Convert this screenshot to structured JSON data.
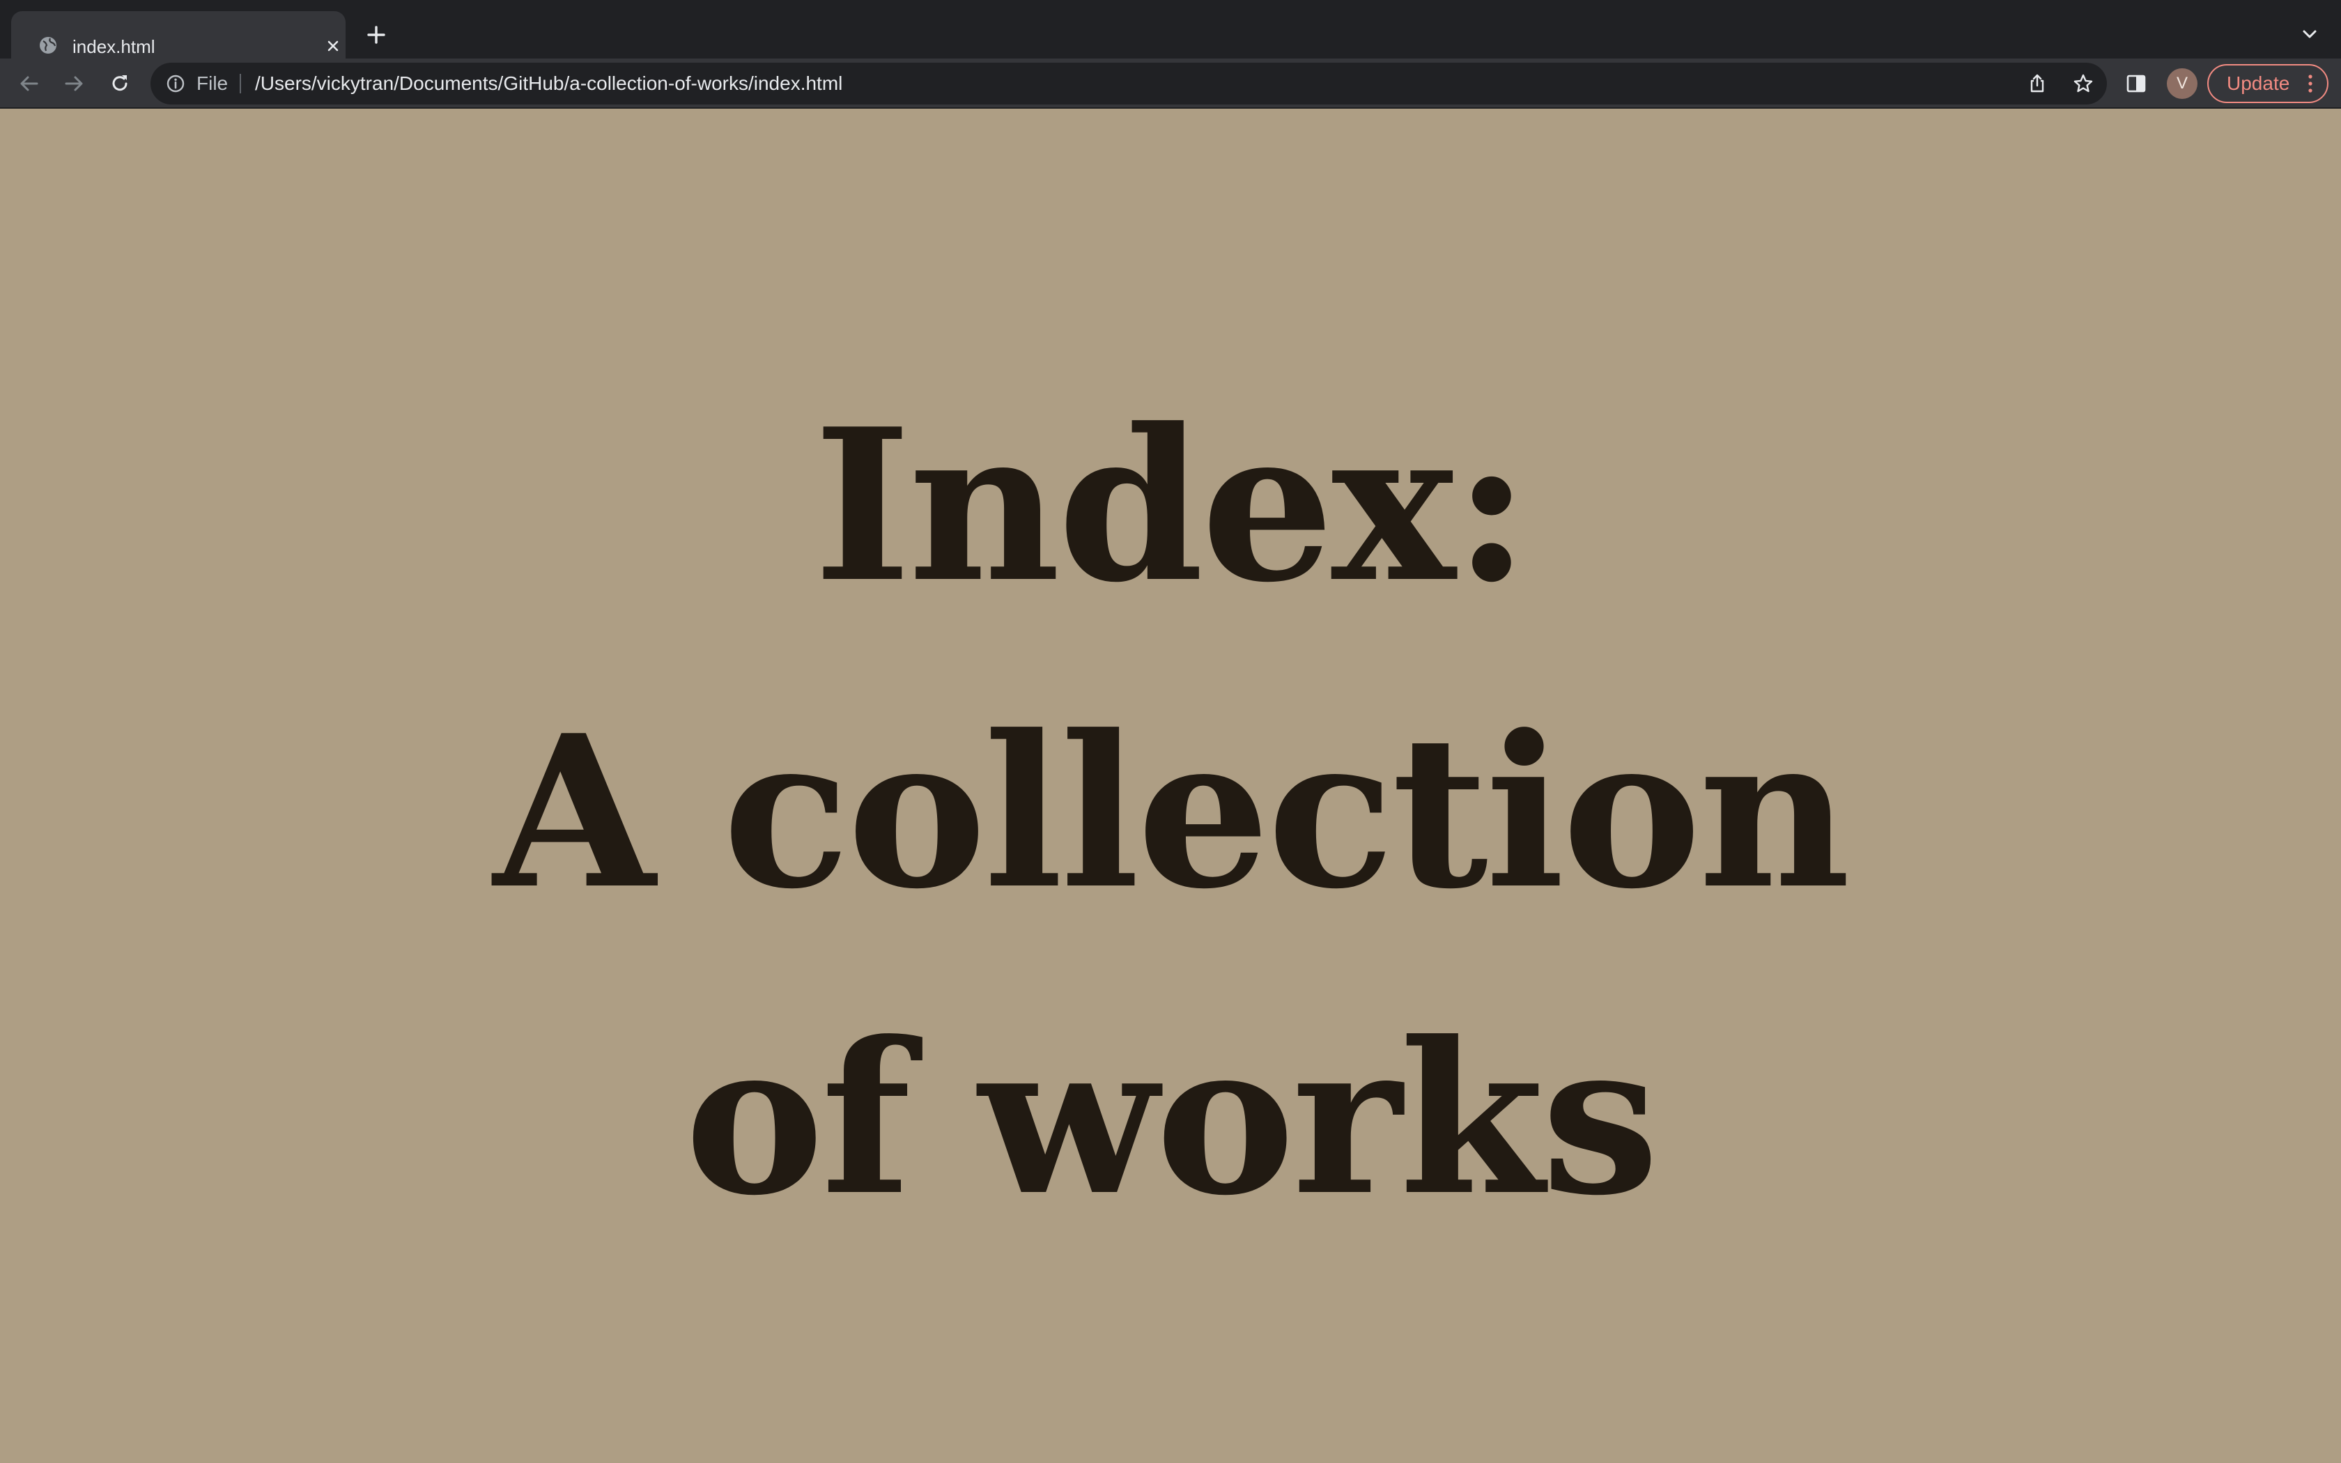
{
  "browser": {
    "tab": {
      "title": "index.html",
      "favicon": "globe-icon"
    },
    "new_tab_icon": "plus-icon",
    "tab_search_icon": "chevron-down-icon",
    "omnibox": {
      "scheme_label": "File",
      "url": "/Users/vickytran/Documents/GitHub/a-collection-of-works/index.html",
      "info_icon": "info-icon",
      "share_icon": "share-icon",
      "bookmark_icon": "star-icon"
    },
    "side_panel_icon": "side-panel-icon",
    "profile_initial": "V",
    "update_label": "Update",
    "menu_icon": "kebab-menu-icon",
    "colors": {
      "chrome_dark": "#202124",
      "toolbar": "#35363a",
      "update_accent": "#f28b82"
    }
  },
  "page": {
    "background": "#ae9e84",
    "text_color": "#211a12",
    "heading_lines": [
      "Index:",
      "A collection",
      "of works"
    ]
  }
}
